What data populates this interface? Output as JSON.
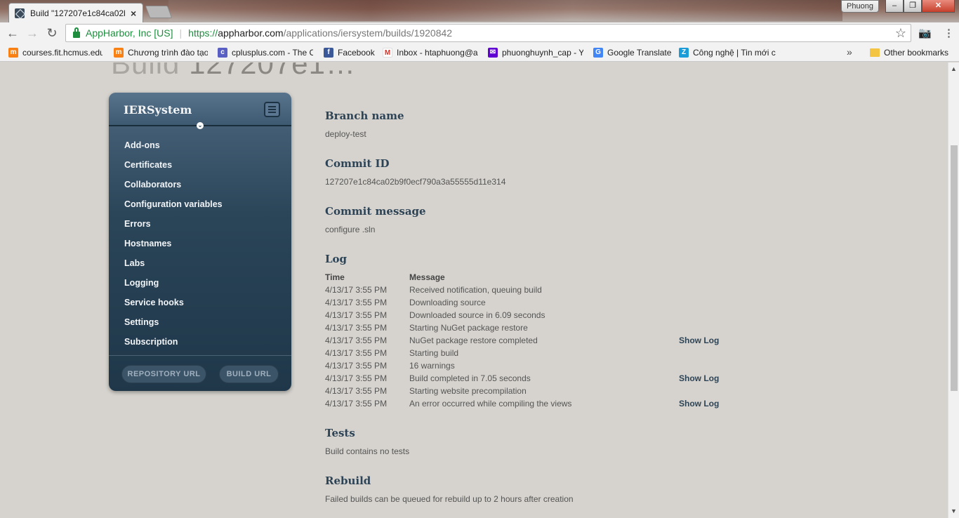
{
  "browser": {
    "tab_title": "Build \"127207e1c84ca02b",
    "tab_close": "×",
    "profile_name": "Phuong",
    "window_controls": {
      "minimize": "–",
      "maximize": "❐",
      "close": "✕"
    },
    "nav": {
      "back": "←",
      "forward": "→",
      "reload": "↻"
    },
    "site_identity": "AppHarbor, Inc [US]",
    "url_scheme": "https://",
    "url_host": "appharbor.com",
    "url_path": "/applications/iersystem/builds/1920842",
    "star": "☆",
    "camera": "📷",
    "menu": "⋮",
    "bookmarks": [
      {
        "label": "courses.fit.hcmus.edu",
        "icon": "moodle-icon",
        "color": "#f98012"
      },
      {
        "label": "Chương trình đào tạo",
        "icon": "moodle-icon",
        "color": "#f98012"
      },
      {
        "label": "cplusplus.com - The C",
        "icon": "cplusplus-icon",
        "color": "#5a5fc4"
      },
      {
        "label": "Facebook",
        "icon": "facebook-icon",
        "color": "#3b5998"
      },
      {
        "label": "Inbox - htaphuong@a",
        "icon": "gmail-icon",
        "color": "#d93025"
      },
      {
        "label": "phuonghuynh_cap - Y",
        "icon": "yahoo-mail-icon",
        "color": "#6001d2"
      },
      {
        "label": "Google Translate",
        "icon": "translate-icon",
        "color": "#4285f4"
      },
      {
        "label": "Công nghệ | Tin mới c",
        "icon": "zing-icon",
        "color": "#1a9cd8"
      }
    ],
    "bookmarks_more": "»",
    "other_bookmarks": "Other bookmarks"
  },
  "page": {
    "heading_light": "Build",
    "heading_id": "127207e1…",
    "sidebar": {
      "app_name": "IERSystem",
      "items": [
        "Add-ons",
        "Certificates",
        "Collaborators",
        "Configuration variables",
        "Errors",
        "Hostnames",
        "Labs",
        "Logging",
        "Service hooks",
        "Settings",
        "Subscription"
      ],
      "repository_url": "REPOSITORY URL",
      "build_url": "BUILD URL"
    },
    "branch": {
      "title": "Branch name",
      "value": "deploy-test"
    },
    "commit": {
      "title": "Commit ID",
      "value": "127207e1c84ca02b9f0ecf790a3a55555d11e314"
    },
    "message": {
      "title": "Commit message",
      "value": "configure .sln"
    },
    "log": {
      "title": "Log",
      "col_time": "Time",
      "col_message": "Message",
      "rows": [
        {
          "time": "4/13/17 3:55 PM",
          "message": "Received notification, queuing build",
          "link": ""
        },
        {
          "time": "4/13/17 3:55 PM",
          "message": "Downloading source",
          "link": ""
        },
        {
          "time": "4/13/17 3:55 PM",
          "message": "Downloaded source in 6.09 seconds",
          "link": ""
        },
        {
          "time": "4/13/17 3:55 PM",
          "message": "Starting NuGet package restore",
          "link": ""
        },
        {
          "time": "4/13/17 3:55 PM",
          "message": "NuGet package restore completed",
          "link": "Show Log"
        },
        {
          "time": "4/13/17 3:55 PM",
          "message": "Starting build",
          "link": ""
        },
        {
          "time": "4/13/17 3:55 PM",
          "message": "16 warnings",
          "link": ""
        },
        {
          "time": "4/13/17 3:55 PM",
          "message": "Build completed in 7.05 seconds",
          "link": "Show Log"
        },
        {
          "time": "4/13/17 3:55 PM",
          "message": "Starting website precompilation",
          "link": ""
        },
        {
          "time": "4/13/17 3:55 PM",
          "message": "An error occurred while compiling the views",
          "link": "Show Log"
        }
      ]
    },
    "tests": {
      "title": "Tests",
      "value": "Build contains no tests"
    },
    "rebuild": {
      "title": "Rebuild",
      "value": "Failed builds can be queued for rebuild up to 2 hours after creation"
    }
  }
}
